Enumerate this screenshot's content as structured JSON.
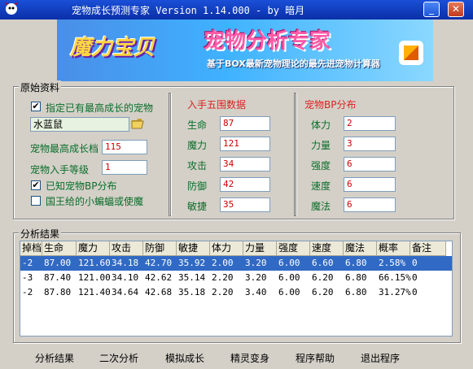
{
  "window": {
    "title": "宠物成长预测专家 Version 1.14.000 - by 暗月",
    "min_label": "_",
    "close_label": "✕"
  },
  "banner": {
    "logo": "魔力宝贝",
    "title": "宠物分析专家",
    "subtitle": "基于BOX最新宠物理论的最先进宠物计算器"
  },
  "original": {
    "group_label": "原始资料",
    "specify_checkbox_label": "指定已有最高成长的宠物",
    "specify_checked": true,
    "pet_name": "水蓝鼠",
    "max_growth_label": "宠物最高成长档",
    "max_growth_value": "115",
    "level_label": "宠物入手等级",
    "level_value": "1",
    "known_bp_label": "已知宠物BP分布",
    "known_bp_checked": true,
    "king_pet_label": "国王给的小蝙蝠或使魔",
    "king_pet_checked": false
  },
  "stats": {
    "title": "入手五围数据",
    "items": [
      {
        "label": "生命",
        "value": "87"
      },
      {
        "label": "魔力",
        "value": "121"
      },
      {
        "label": "攻击",
        "value": "34"
      },
      {
        "label": "防御",
        "value": "42"
      },
      {
        "label": "敏捷",
        "value": "35"
      }
    ]
  },
  "bp": {
    "title": "宠物BP分布",
    "items": [
      {
        "label": "体力",
        "value": "2"
      },
      {
        "label": "力量",
        "value": "3"
      },
      {
        "label": "强度",
        "value": "6"
      },
      {
        "label": "速度",
        "value": "6"
      },
      {
        "label": "魔法",
        "value": "6"
      }
    ]
  },
  "results": {
    "group_label": "分析结果",
    "columns": [
      "掉档",
      "生命",
      "魔力",
      "攻击",
      "防御",
      "敏捷",
      "体力",
      "力量",
      "强度",
      "速度",
      "魔法",
      "概率",
      "备注"
    ],
    "rows": [
      [
        "-2",
        "87.00",
        "121.60",
        "34.18",
        "42.70",
        "35.92",
        "2.00",
        "3.20",
        "6.00",
        "6.60",
        "6.80",
        "2.58%",
        "0"
      ],
      [
        "-3",
        "87.40",
        "121.00",
        "34.10",
        "42.62",
        "35.14",
        "2.20",
        "3.20",
        "6.00",
        "6.20",
        "6.80",
        "66.15%",
        "0"
      ],
      [
        "-2",
        "87.80",
        "121.40",
        "34.64",
        "42.68",
        "35.18",
        "2.20",
        "3.40",
        "6.00",
        "6.20",
        "6.80",
        "31.27%",
        "0"
      ]
    ],
    "selected_row": 0
  },
  "buttons": [
    "分析结果",
    "二次分析",
    "模拟成长",
    "精灵变身",
    "程序帮助",
    "退出程序"
  ],
  "colors": {
    "accent": "#316ac5",
    "label_green": "#0a6e2a",
    "label_red": "#dd2222"
  }
}
